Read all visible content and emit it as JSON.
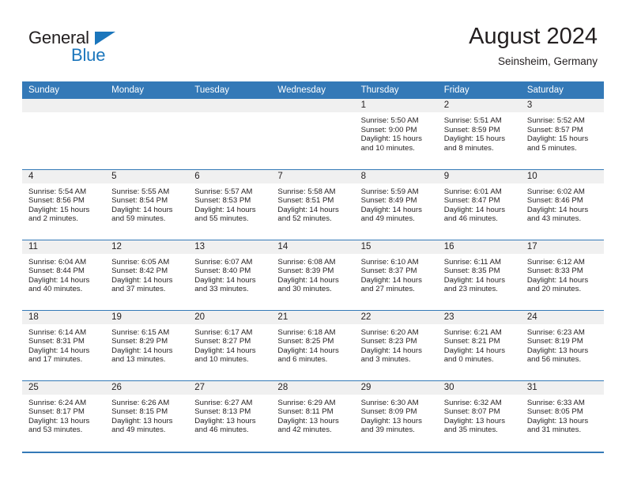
{
  "brand": {
    "name_part1": "General",
    "name_part2": "Blue",
    "triangle_icon": "triangle-icon",
    "colors": {
      "dark": "#231f20",
      "blue": "#1b76bc",
      "header_blue": "#3479b7",
      "band_gray": "#f0f0f0"
    }
  },
  "header": {
    "title": "August 2024",
    "subtitle": "Seinsheim, Germany"
  },
  "weekday_headers": [
    "Sunday",
    "Monday",
    "Tuesday",
    "Wednesday",
    "Thursday",
    "Friday",
    "Saturday"
  ],
  "weeks": [
    [
      {
        "day": "",
        "empty": true
      },
      {
        "day": "",
        "empty": true
      },
      {
        "day": "",
        "empty": true
      },
      {
        "day": "",
        "empty": true
      },
      {
        "day": "1",
        "sunrise": "Sunrise: 5:50 AM",
        "sunset": "Sunset: 9:00 PM",
        "daylight_line1": "Daylight: 15 hours",
        "daylight_line2": "and 10 minutes."
      },
      {
        "day": "2",
        "sunrise": "Sunrise: 5:51 AM",
        "sunset": "Sunset: 8:59 PM",
        "daylight_line1": "Daylight: 15 hours",
        "daylight_line2": "and 8 minutes."
      },
      {
        "day": "3",
        "sunrise": "Sunrise: 5:52 AM",
        "sunset": "Sunset: 8:57 PM",
        "daylight_line1": "Daylight: 15 hours",
        "daylight_line2": "and 5 minutes."
      }
    ],
    [
      {
        "day": "4",
        "sunrise": "Sunrise: 5:54 AM",
        "sunset": "Sunset: 8:56 PM",
        "daylight_line1": "Daylight: 15 hours",
        "daylight_line2": "and 2 minutes."
      },
      {
        "day": "5",
        "sunrise": "Sunrise: 5:55 AM",
        "sunset": "Sunset: 8:54 PM",
        "daylight_line1": "Daylight: 14 hours",
        "daylight_line2": "and 59 minutes."
      },
      {
        "day": "6",
        "sunrise": "Sunrise: 5:57 AM",
        "sunset": "Sunset: 8:53 PM",
        "daylight_line1": "Daylight: 14 hours",
        "daylight_line2": "and 55 minutes."
      },
      {
        "day": "7",
        "sunrise": "Sunrise: 5:58 AM",
        "sunset": "Sunset: 8:51 PM",
        "daylight_line1": "Daylight: 14 hours",
        "daylight_line2": "and 52 minutes."
      },
      {
        "day": "8",
        "sunrise": "Sunrise: 5:59 AM",
        "sunset": "Sunset: 8:49 PM",
        "daylight_line1": "Daylight: 14 hours",
        "daylight_line2": "and 49 minutes."
      },
      {
        "day": "9",
        "sunrise": "Sunrise: 6:01 AM",
        "sunset": "Sunset: 8:47 PM",
        "daylight_line1": "Daylight: 14 hours",
        "daylight_line2": "and 46 minutes."
      },
      {
        "day": "10",
        "sunrise": "Sunrise: 6:02 AM",
        "sunset": "Sunset: 8:46 PM",
        "daylight_line1": "Daylight: 14 hours",
        "daylight_line2": "and 43 minutes."
      }
    ],
    [
      {
        "day": "11",
        "sunrise": "Sunrise: 6:04 AM",
        "sunset": "Sunset: 8:44 PM",
        "daylight_line1": "Daylight: 14 hours",
        "daylight_line2": "and 40 minutes."
      },
      {
        "day": "12",
        "sunrise": "Sunrise: 6:05 AM",
        "sunset": "Sunset: 8:42 PM",
        "daylight_line1": "Daylight: 14 hours",
        "daylight_line2": "and 37 minutes."
      },
      {
        "day": "13",
        "sunrise": "Sunrise: 6:07 AM",
        "sunset": "Sunset: 8:40 PM",
        "daylight_line1": "Daylight: 14 hours",
        "daylight_line2": "and 33 minutes."
      },
      {
        "day": "14",
        "sunrise": "Sunrise: 6:08 AM",
        "sunset": "Sunset: 8:39 PM",
        "daylight_line1": "Daylight: 14 hours",
        "daylight_line2": "and 30 minutes."
      },
      {
        "day": "15",
        "sunrise": "Sunrise: 6:10 AM",
        "sunset": "Sunset: 8:37 PM",
        "daylight_line1": "Daylight: 14 hours",
        "daylight_line2": "and 27 minutes."
      },
      {
        "day": "16",
        "sunrise": "Sunrise: 6:11 AM",
        "sunset": "Sunset: 8:35 PM",
        "daylight_line1": "Daylight: 14 hours",
        "daylight_line2": "and 23 minutes."
      },
      {
        "day": "17",
        "sunrise": "Sunrise: 6:12 AM",
        "sunset": "Sunset: 8:33 PM",
        "daylight_line1": "Daylight: 14 hours",
        "daylight_line2": "and 20 minutes."
      }
    ],
    [
      {
        "day": "18",
        "sunrise": "Sunrise: 6:14 AM",
        "sunset": "Sunset: 8:31 PM",
        "daylight_line1": "Daylight: 14 hours",
        "daylight_line2": "and 17 minutes."
      },
      {
        "day": "19",
        "sunrise": "Sunrise: 6:15 AM",
        "sunset": "Sunset: 8:29 PM",
        "daylight_line1": "Daylight: 14 hours",
        "daylight_line2": "and 13 minutes."
      },
      {
        "day": "20",
        "sunrise": "Sunrise: 6:17 AM",
        "sunset": "Sunset: 8:27 PM",
        "daylight_line1": "Daylight: 14 hours",
        "daylight_line2": "and 10 minutes."
      },
      {
        "day": "21",
        "sunrise": "Sunrise: 6:18 AM",
        "sunset": "Sunset: 8:25 PM",
        "daylight_line1": "Daylight: 14 hours",
        "daylight_line2": "and 6 minutes."
      },
      {
        "day": "22",
        "sunrise": "Sunrise: 6:20 AM",
        "sunset": "Sunset: 8:23 PM",
        "daylight_line1": "Daylight: 14 hours",
        "daylight_line2": "and 3 minutes."
      },
      {
        "day": "23",
        "sunrise": "Sunrise: 6:21 AM",
        "sunset": "Sunset: 8:21 PM",
        "daylight_line1": "Daylight: 14 hours",
        "daylight_line2": "and 0 minutes."
      },
      {
        "day": "24",
        "sunrise": "Sunrise: 6:23 AM",
        "sunset": "Sunset: 8:19 PM",
        "daylight_line1": "Daylight: 13 hours",
        "daylight_line2": "and 56 minutes."
      }
    ],
    [
      {
        "day": "25",
        "sunrise": "Sunrise: 6:24 AM",
        "sunset": "Sunset: 8:17 PM",
        "daylight_line1": "Daylight: 13 hours",
        "daylight_line2": "and 53 minutes."
      },
      {
        "day": "26",
        "sunrise": "Sunrise: 6:26 AM",
        "sunset": "Sunset: 8:15 PM",
        "daylight_line1": "Daylight: 13 hours",
        "daylight_line2": "and 49 minutes."
      },
      {
        "day": "27",
        "sunrise": "Sunrise: 6:27 AM",
        "sunset": "Sunset: 8:13 PM",
        "daylight_line1": "Daylight: 13 hours",
        "daylight_line2": "and 46 minutes."
      },
      {
        "day": "28",
        "sunrise": "Sunrise: 6:29 AM",
        "sunset": "Sunset: 8:11 PM",
        "daylight_line1": "Daylight: 13 hours",
        "daylight_line2": "and 42 minutes."
      },
      {
        "day": "29",
        "sunrise": "Sunrise: 6:30 AM",
        "sunset": "Sunset: 8:09 PM",
        "daylight_line1": "Daylight: 13 hours",
        "daylight_line2": "and 39 minutes."
      },
      {
        "day": "30",
        "sunrise": "Sunrise: 6:32 AM",
        "sunset": "Sunset: 8:07 PM",
        "daylight_line1": "Daylight: 13 hours",
        "daylight_line2": "and 35 minutes."
      },
      {
        "day": "31",
        "sunrise": "Sunrise: 6:33 AM",
        "sunset": "Sunset: 8:05 PM",
        "daylight_line1": "Daylight: 13 hours",
        "daylight_line2": "and 31 minutes."
      }
    ]
  ]
}
